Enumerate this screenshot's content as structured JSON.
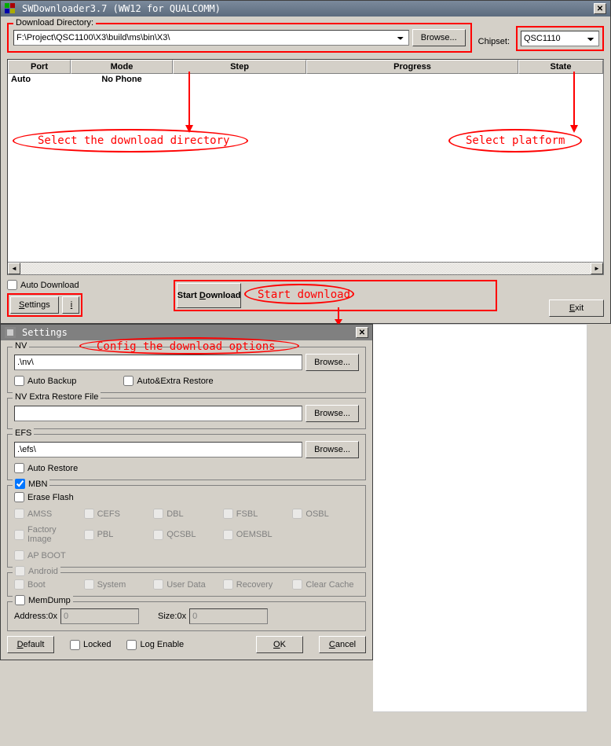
{
  "main": {
    "title": "SWDownloader3.7 (WW12 for QUALCOMM)",
    "downloadDir": {
      "label": "Download Directory:",
      "value": "F:\\Project\\QSC1100\\X3\\build\\ms\\bin\\X3\\",
      "browse": "Browse..."
    },
    "chipset": {
      "label": "Chipset:",
      "value": "QSC1110"
    },
    "table": {
      "headers": {
        "port": "Port",
        "mode": "Mode",
        "step": "Step",
        "progress": "Progress",
        "state": "State"
      },
      "row": {
        "port": "Auto",
        "mode": "No Phone",
        "step": "",
        "progress": "",
        "state": ""
      }
    },
    "autoDownload": "Auto Download",
    "settings": "Settings",
    "info": "i",
    "startDownload": "Start Download",
    "exit": "Exit"
  },
  "annotations": {
    "selectDir": "Select the download directory",
    "selectPlatform": "Select platform",
    "startDl": "Start download",
    "configOptions": "Config the download options"
  },
  "settings": {
    "title": "Settings",
    "nv": {
      "legend": "NV",
      "path": ".\\nv\\",
      "browse": "Browse...",
      "autoBackup": "Auto Backup",
      "autoExtra": "Auto&Extra Restore"
    },
    "nvExtra": {
      "legend": "NV Extra Restore File",
      "path": "",
      "browse": "Browse..."
    },
    "efs": {
      "legend": "EFS",
      "path": ".\\efs\\",
      "browse": "Browse...",
      "autoRestore": "Auto Restore"
    },
    "mbn": {
      "legend": "MBN",
      "eraseFlash": "Erase Flash",
      "items": [
        "AMSS",
        "CEFS",
        "DBL",
        "FSBL",
        "OSBL",
        "Factory Image",
        "PBL",
        "QCSBL",
        "OEMSBL",
        "AP BOOT"
      ]
    },
    "android": {
      "legend": "Android",
      "items": [
        "Boot",
        "System",
        "User Data",
        "Recovery",
        "Clear Cache"
      ]
    },
    "memdump": {
      "legend": "MemDump",
      "addrLabel": "Address:0x",
      "addrVal": "0",
      "sizeLabel": "Size:0x",
      "sizeVal": "0"
    },
    "buttons": {
      "default": "Default",
      "locked": "Locked",
      "logEnable": "Log Enable",
      "ok": "OK",
      "cancel": "Cancel"
    }
  }
}
